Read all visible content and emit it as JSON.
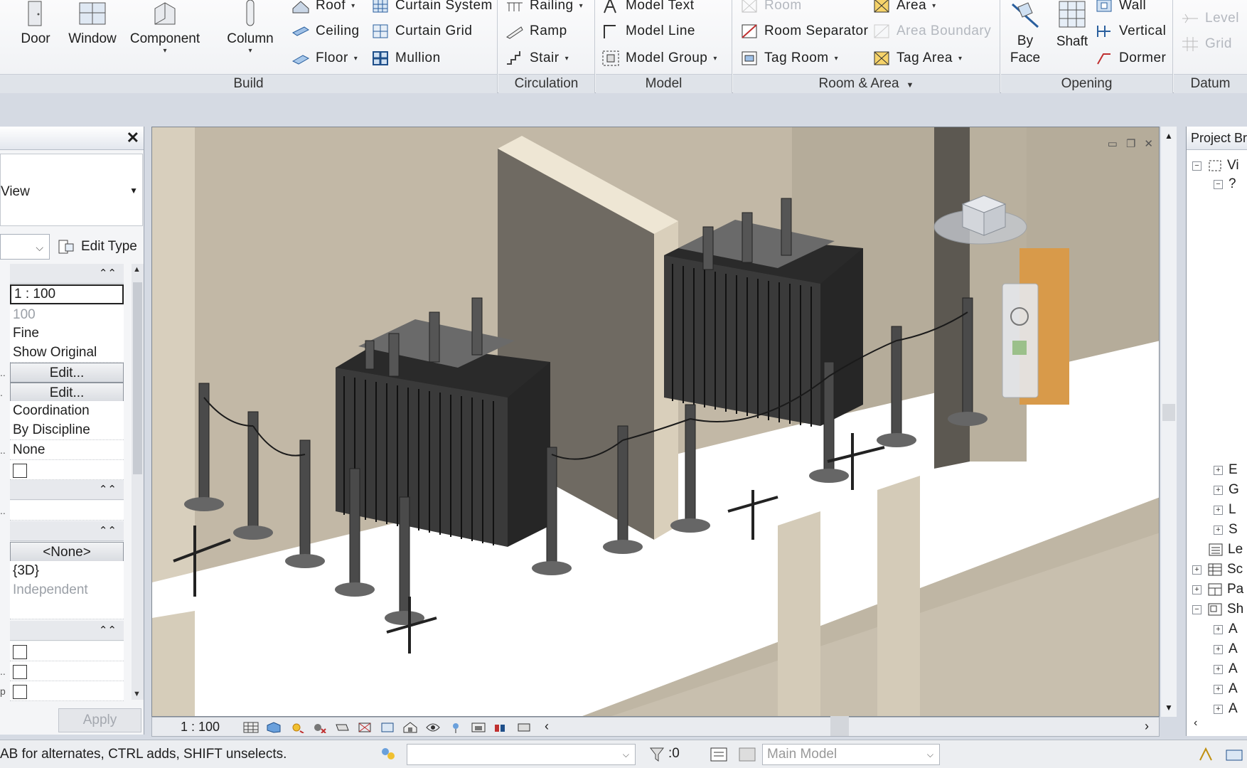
{
  "ribbon": {
    "build": {
      "title": "Build",
      "door": "Door",
      "window": "Window",
      "component": "Component",
      "column": "Column",
      "roof": "Roof",
      "ceiling": "Ceiling",
      "floor": "Floor",
      "curtain_system": "Curtain System",
      "curtain_grid": "Curtain Grid",
      "mullion": "Mullion"
    },
    "circulation": {
      "title": "Circulation",
      "railing": "Railing",
      "ramp": "Ramp",
      "stair": "Stair"
    },
    "model": {
      "title": "Model",
      "model_text": "Model Text",
      "model_line": "Model Line",
      "model_group": "Model Group"
    },
    "room_area": {
      "title": "Room & Area",
      "room": "Room",
      "room_separator": "Room Separator",
      "tag_room": "Tag Room",
      "area": "Area",
      "area_boundary": "Area Boundary",
      "tag_area": "Tag Area"
    },
    "opening": {
      "title": "Opening",
      "by_face": "By Face",
      "by_face_1": "By",
      "by_face_2": "Face",
      "shaft": "Shaft",
      "wall": "Wall",
      "vertical": "Vertical",
      "dormer": "Dormer"
    },
    "datum": {
      "title": "Datum",
      "level": "Level",
      "grid": "Grid"
    }
  },
  "properties": {
    "type_label": "View",
    "edit_type": "Edit Type",
    "rows": {
      "scale": "1 : 100",
      "scale_value": "100",
      "detail_level": "Fine",
      "parts_visibility": "Show Original",
      "vg_overrides": "Edit...",
      "graphic_display": "Edit...",
      "discipline": "Coordination",
      "show_hidden": "By Discipline",
      "default_analysis": "None",
      "template": "<None>",
      "view_name": "{3D}",
      "dependency": "Independent"
    },
    "apply": "Apply"
  },
  "viewport": {
    "scale": "1 : 100"
  },
  "browser": {
    "title": "Project Br",
    "nodes": [
      "Vi",
      "?",
      "E",
      "G",
      "L",
      "S",
      "Le",
      "Sc",
      "Pa",
      "Sh",
      "A",
      "A",
      "A",
      "A",
      "A"
    ]
  },
  "status": {
    "hint": "AB for alternates, CTRL adds, SHIFT unselects.",
    "selection_count": ":0",
    "model": "Main Model"
  }
}
